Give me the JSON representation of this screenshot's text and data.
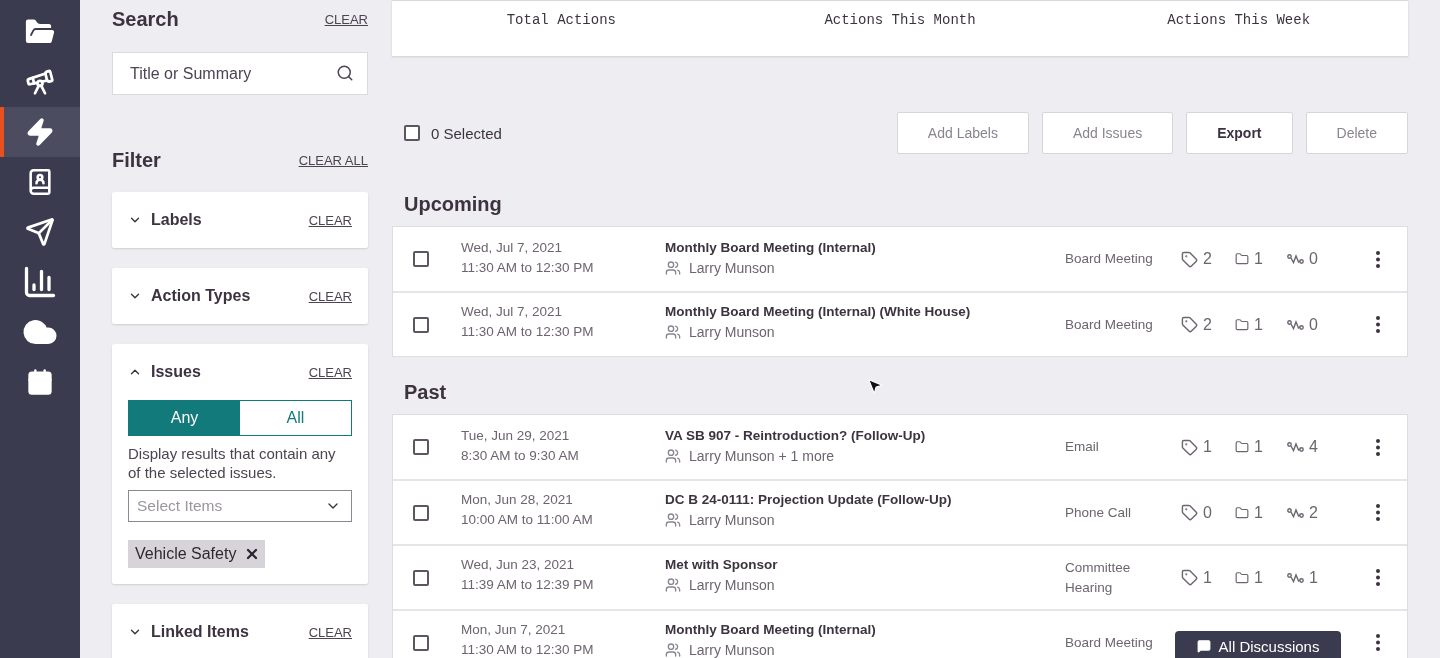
{
  "nav_items": [
    {
      "selected": false
    },
    {
      "selected": false
    },
    {
      "selected": true
    },
    {
      "selected": false
    },
    {
      "selected": false
    },
    {
      "selected": false
    },
    {
      "selected": false
    },
    {
      "selected": false
    }
  ],
  "search": {
    "title": "Search",
    "clear": "CLEAR",
    "placeholder": "Title or Summary"
  },
  "filter": {
    "title": "Filter",
    "clear_all": "CLEAR ALL",
    "sections": [
      {
        "title": "Labels",
        "clear": "CLEAR",
        "expanded": false
      },
      {
        "title": "Action Types",
        "clear": "CLEAR",
        "expanded": false
      },
      {
        "title": "Issues",
        "clear": "CLEAR",
        "expanded": true,
        "match": [
          {
            "label": "Any",
            "selected": true
          },
          {
            "label": "All",
            "selected": false
          }
        ],
        "hint": "Display results that contain any of the selected issues.",
        "select_placeholder": "Select Items",
        "chips": [
          "Vehicle Safety"
        ]
      },
      {
        "title": "Linked Items",
        "clear": "CLEAR",
        "expanded": false
      }
    ]
  },
  "stats": [
    "Total Actions",
    "Actions This Month",
    "Actions This Week"
  ],
  "toolbar": {
    "select_all": {
      "checked": false,
      "label": "0 Selected"
    },
    "buttons": [
      {
        "label": "Add Labels",
        "disabled": true
      },
      {
        "label": "Add Issues",
        "disabled": true
      },
      {
        "label": "Export",
        "disabled": false
      },
      {
        "label": "Delete",
        "disabled": true
      }
    ]
  },
  "groups": [
    {
      "title": "Upcoming",
      "rows": [
        {
          "checked": false,
          "date": "Wed, Jul 7, 2021",
          "time": "11:30 AM to 12:30 PM",
          "title": "Monthly Board Meeting (Internal)",
          "people": "Larry Munson",
          "type": "Board Meeting",
          "labels": "2",
          "issues": "1",
          "links": "0"
        },
        {
          "checked": false,
          "date": "Wed, Jul 7, 2021",
          "time": "11:30 AM to 12:30 PM",
          "title": "Monthly Board Meeting (Internal) (White House)",
          "people": "Larry Munson",
          "type": "Board Meeting",
          "labels": "2",
          "issues": "1",
          "links": "0"
        }
      ]
    },
    {
      "title": "Past",
      "rows": [
        {
          "checked": false,
          "date": "Tue, Jun 29, 2021",
          "time": "8:30 AM to 9:30 AM",
          "title": "VA SB 907 - Reintroduction? (Follow-Up)",
          "people": "Larry Munson + 1 more",
          "type": "Email",
          "labels": "1",
          "issues": "1",
          "links": "4"
        },
        {
          "checked": false,
          "date": "Mon, Jun 28, 2021",
          "time": "10:00 AM to 11:00 AM",
          "title": "DC B 24-0111: Projection Update (Follow-Up)",
          "people": "Larry Munson",
          "type": "Phone Call",
          "labels": "0",
          "issues": "1",
          "links": "2"
        },
        {
          "checked": false,
          "date": "Wed, Jun 23, 2021",
          "time": "11:39 AM to 12:39 PM",
          "title": "Met with Sponsor",
          "people": "Larry Munson",
          "type": "Committee Hearing",
          "labels": "1",
          "issues": "1",
          "links": "1"
        },
        {
          "checked": false,
          "date": "Mon, Jun 7, 2021",
          "time": "11:30 AM to 12:30 PM",
          "title": "Monthly Board Meeting (Internal)",
          "people": "Larry Munson",
          "type": "Board Meeting",
          "tooltip": "All Discussions"
        }
      ]
    }
  ]
}
